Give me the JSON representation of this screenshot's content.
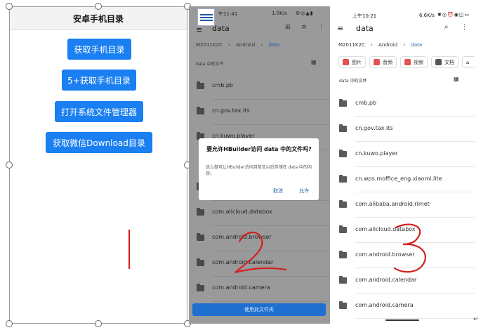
{
  "panel1": {
    "title": "安卓手机目录",
    "buttons": [
      "获取手机目录",
      "5+获取手机目录",
      "打开系统文件管理器",
      "获取微信Download目录"
    ]
  },
  "panel2": {
    "status_time": "午11:41",
    "status_right": "1.0K/s",
    "toolbar_title": "data",
    "breadcrumb": [
      "M2011K2C",
      "Android",
      "data"
    ],
    "section_label": "data 中的文件",
    "files": [
      "cmb.pb",
      "cn.gov.tax.its",
      "cn.kuwo.player",
      "",
      "",
      "com.alicloud.databox",
      "com.android.browser",
      "com.android.calendar",
      "com.android.camera"
    ],
    "dialog": {
      "title": "要允许HBuilder访问 data 中的文件吗?",
      "body": "这么做可让HBuilder访问目前及以后存储在 data 中的内容。",
      "cancel": "取消",
      "allow": "允许"
    },
    "bottom_button": "使用此文件夹",
    "annotation": "2"
  },
  "panel3": {
    "status_time": "上午10:21",
    "status_right": "6.6K/s",
    "toolbar_title": "data",
    "breadcrumb": [
      "M2011K2C",
      "Android",
      "data"
    ],
    "chips": [
      {
        "label": "图片",
        "icon": "image-icon",
        "color": "#e05353"
      },
      {
        "label": "音频",
        "icon": "audio-icon",
        "color": "#e05353"
      },
      {
        "label": "视频",
        "icon": "video-icon",
        "color": "#e05353"
      },
      {
        "label": "文档",
        "icon": "document-icon",
        "color": "#555555"
      }
    ],
    "section_label": "data 中的文件",
    "files": [
      "cmb.pb",
      "cn.gov.tax.its",
      "cn.kuwo.player",
      "cn.wps.moffice_eng.xiaomi.lite",
      "com.alibaba.android.rimet",
      "com.alicloud.databox",
      "com.android.browser",
      "com.android.calendar",
      "com.android.camera"
    ],
    "annotation": "3"
  },
  "colors": {
    "accent": "#1a7ff0",
    "annotation": "#d32020"
  }
}
